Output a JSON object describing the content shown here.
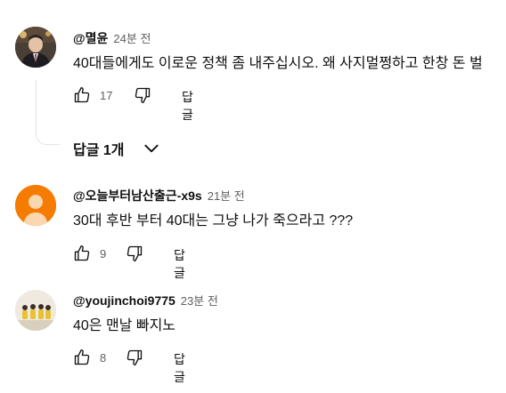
{
  "comments": [
    {
      "author": "@멸윤",
      "time": "24분 전",
      "text": "40대들에게도 이로운 정책 좀 내주십시오. 왜 사지멀쩡하고 한창 돈 벌",
      "likes": "17",
      "reply_label": "답글",
      "avatar_icon": "user-photo-avatar"
    },
    {
      "author": "@오늘부터남산출근-x9s",
      "time": "21분 전",
      "text": "30대 후반 부터 40대는 그냥 나가 죽으라고 ???",
      "likes": "9",
      "reply_label": "답글",
      "avatar_icon": "default-orange-avatar",
      "avatar_color": "#f57c00"
    },
    {
      "author": "@youjinchoi9775",
      "time": "23분 전",
      "text": "40은 맨날 빠지노",
      "likes": "8",
      "reply_label": "답글",
      "avatar_icon": "group-photo-avatar"
    }
  ],
  "replies_toggle": {
    "label": "답글 1개"
  },
  "icons": {
    "like": "thumbs-up-icon",
    "dislike": "thumbs-down-icon",
    "expand": "chevron-down-icon"
  }
}
